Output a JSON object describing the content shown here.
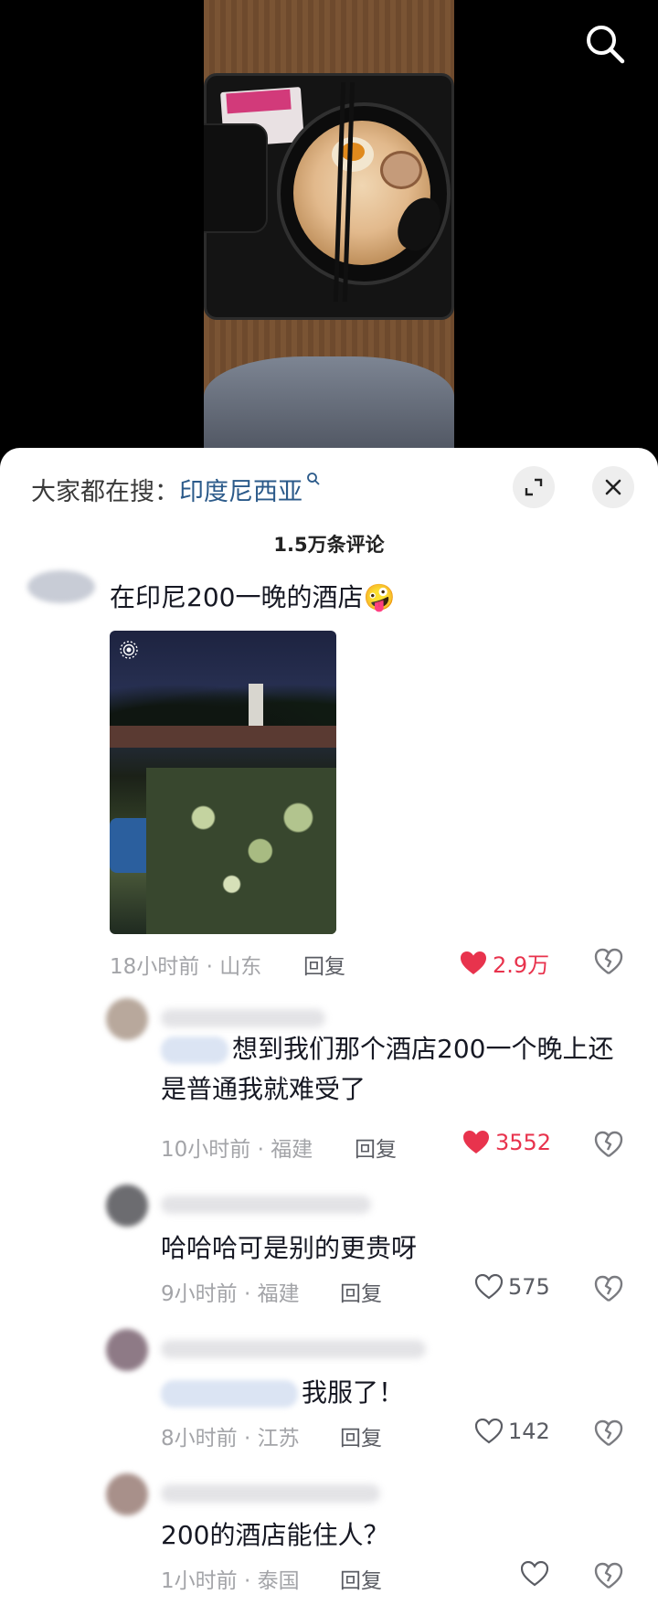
{
  "trending": {
    "prefix": "大家都在搜：",
    "keyword": "印度尼西亚"
  },
  "comment_count": "1.5万条评论",
  "comments": [
    {
      "text": "在印尼200一晚的酒店",
      "emoji": "🤪",
      "time": "18小时前 · 山东",
      "reply": "回复",
      "likes": "2.9万",
      "liked": true,
      "has_image": true
    },
    {
      "text": "想到我们那个酒店200一个晚上还是普通我就难受了",
      "line1": "想到我们那个酒店200一个晚上还",
      "line2": "是普通我就难受了",
      "time": "10小时前 · 福建",
      "reply": "回复",
      "likes": "3552",
      "liked": true
    },
    {
      "text": "哈哈哈可是别的更贵呀",
      "time": "9小时前 · 福建",
      "reply": "回复",
      "likes": "575",
      "liked": false
    },
    {
      "text": "我服了！",
      "time": "8小时前 · 江苏",
      "reply": "回复",
      "likes": "142",
      "liked": false
    },
    {
      "text": "200的酒店能住人？",
      "time": "1小时前 · 泰国",
      "reply": "回复",
      "likes": "",
      "liked": false
    }
  ],
  "colors": {
    "like_active": "#e8334d",
    "link": "#2b5a8a",
    "meta": "#a3a4a8"
  },
  "icons": [
    "search-icon",
    "expand-icon",
    "close-icon",
    "heart-icon",
    "dislike-icon",
    "live-photo-icon"
  ]
}
